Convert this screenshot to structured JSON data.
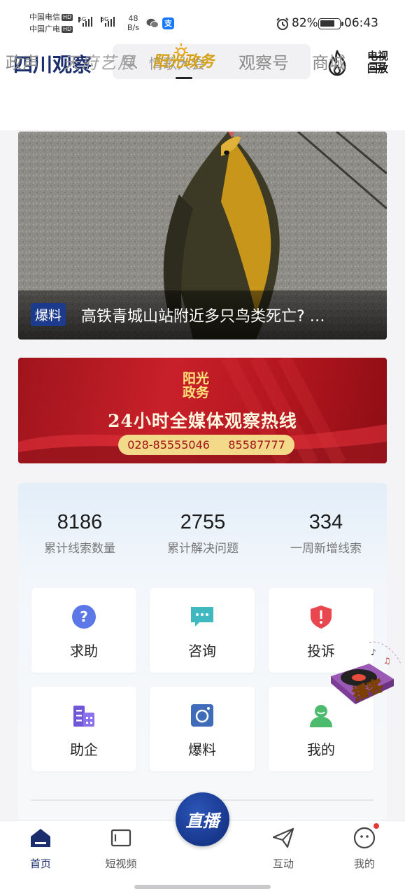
{
  "status_bar": {
    "carrier1": "中国电信",
    "carrier2": "中国广电",
    "hd": "HD",
    "net_type1": "5G",
    "net_type2": "5G",
    "net_speed_value": "48",
    "net_speed_unit": "B/s",
    "battery": "82%",
    "time": "06:43"
  },
  "header": {
    "logo": "四川观察",
    "search_placeholder": "情歌大会",
    "tv_replay": "电视回放"
  },
  "channels": {
    "items": [
      "政声",
      "天府艺展",
      "阳光政务",
      "观察号",
      "商城"
    ],
    "active": "阳光政务"
  },
  "hero": {
    "tag": "爆料",
    "title": "高铁青城山站附近多只鸟类死亡? …"
  },
  "banner": {
    "logo_line1": "阳光",
    "logo_line2": "政务",
    "headline": "24小时全媒体观察热线",
    "phone1": "028-85555046",
    "phone2": "85587777",
    "colors": {
      "red": "#c8202a",
      "gold": "#f3d98a"
    }
  },
  "stats": [
    {
      "value": "8186",
      "label": "累计线索数量"
    },
    {
      "value": "2755",
      "label": "累计解决问题"
    },
    {
      "value": "334",
      "label": "一周新增线索"
    }
  ],
  "tiles": [
    {
      "label": "求助",
      "icon": "help-icon"
    },
    {
      "label": "咨询",
      "icon": "chat-icon"
    },
    {
      "label": "投诉",
      "icon": "complaint-shield-icon"
    },
    {
      "label": "助企",
      "icon": "building-icon"
    },
    {
      "label": "爆料",
      "icon": "camera-icon"
    },
    {
      "label": "我的",
      "icon": "user-icon"
    }
  ],
  "podcast_widget": {
    "label": "播客"
  },
  "bottom_nav": {
    "items": [
      {
        "label": "首页",
        "icon": "home-icon",
        "active": true
      },
      {
        "label": "短视频",
        "icon": "video-icon"
      },
      {
        "label": "直播",
        "icon": "live-icon"
      },
      {
        "label": "互动",
        "icon": "paper-plane-icon"
      },
      {
        "label": "我的",
        "icon": "profile-face-icon"
      }
    ],
    "accent": "#1a2e6e"
  }
}
